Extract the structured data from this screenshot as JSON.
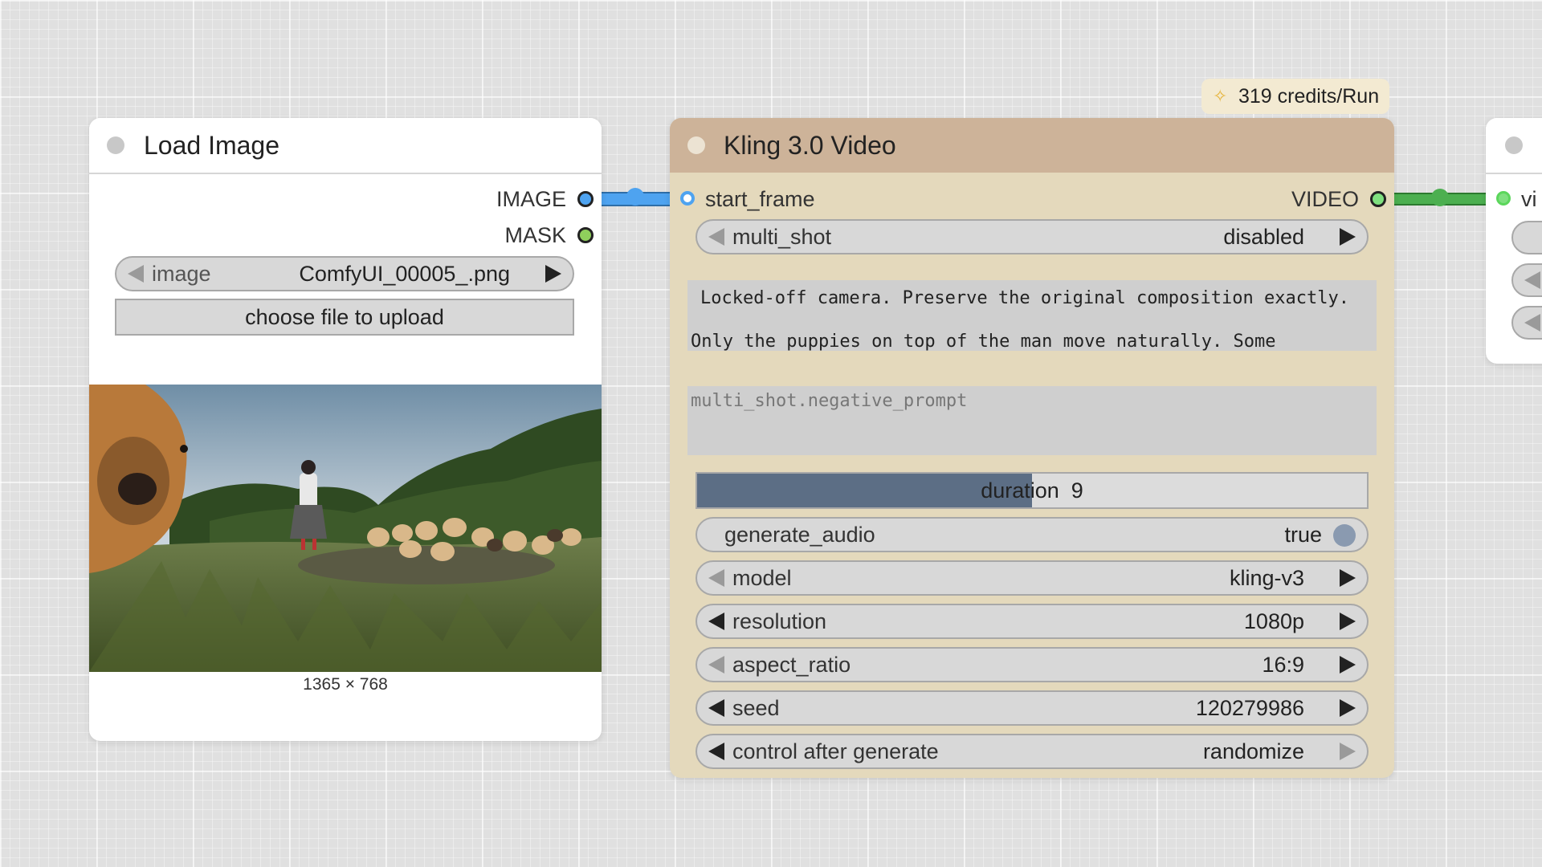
{
  "credits_badge": {
    "text": "319 credits/Run"
  },
  "load_image_node": {
    "title": "Load Image",
    "outputs": [
      "IMAGE",
      "MASK"
    ],
    "image_widget": {
      "label": "image",
      "value": "ComfyUI_00005_.png"
    },
    "upload_button": "choose file to upload",
    "image_size": "1365 × 768"
  },
  "kling_node": {
    "title": "Kling 3.0 Video",
    "input": "start_frame",
    "output": "VIDEO",
    "multi_shot": {
      "label": "multi_shot",
      "value": "disabled"
    },
    "prompt_lines": [
      "Locked-off camera. Preserve the original composition exactly.",
      "Only the puppies on top of the man move naturally. Some"
    ],
    "negative_prompt_placeholder": "multi_shot.negative_prompt",
    "duration": {
      "label": "duration",
      "value": "9",
      "fill_fraction": 0.5
    },
    "generate_audio": {
      "label": "generate_audio",
      "value": "true"
    },
    "model": {
      "label": "model",
      "value": "kling-v3"
    },
    "resolution": {
      "label": "resolution",
      "value": "1080p"
    },
    "aspect_ratio": {
      "label": "aspect_ratio",
      "value": "16:9"
    },
    "seed": {
      "label": "seed",
      "value": "120279986"
    },
    "control_after_generate": {
      "label": "control after generate",
      "value": "randomize"
    }
  },
  "right_node": {
    "input_partial": "vi"
  },
  "colors": {
    "image_link": "#4ea3f0",
    "video_link": "#4caf50",
    "kling_header": "#cdb399",
    "kling_body": "#e4d9bc",
    "duration_fill": "#5c6e85"
  }
}
